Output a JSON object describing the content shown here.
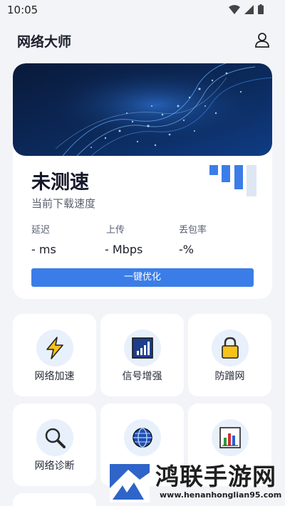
{
  "status_bar": {
    "time": "10:05"
  },
  "header": {
    "title": "网络大师"
  },
  "speed_card": {
    "status": "未测速",
    "subtitle": "当前下载速度",
    "metrics": [
      {
        "label": "延迟",
        "value": "- ms"
      },
      {
        "label": "上传",
        "value": "- Mbps"
      },
      {
        "label": "丢包率",
        "value": "-%"
      }
    ],
    "optimize_button": "一键优化"
  },
  "tools": [
    {
      "label": "网络加速",
      "icon": "lightning-icon"
    },
    {
      "label": "信号增强",
      "icon": "signal-boost-icon"
    },
    {
      "label": "防蹭网",
      "icon": "lock-icon"
    },
    {
      "label": "网络诊断",
      "icon": "magnifier-icon"
    },
    {
      "label": "",
      "icon": "globe-icon"
    },
    {
      "label": "",
      "icon": "bar-chart-icon"
    }
  ],
  "watermark": {
    "title": "鸿联手游网",
    "url": "www.henanhonglian95.com"
  },
  "colors": {
    "accent": "#3b7de8",
    "background": "#f2f4f8",
    "card": "#ffffff"
  }
}
